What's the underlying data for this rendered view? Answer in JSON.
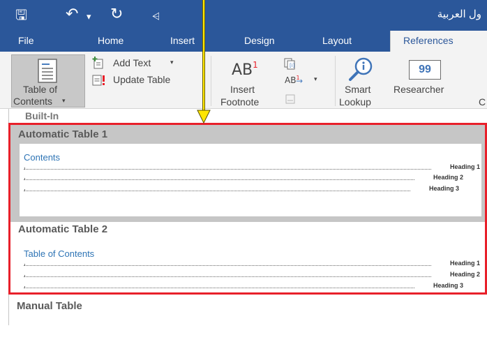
{
  "window": {
    "title": "ول العربية",
    "qat_icons": [
      "save-icon",
      "undo-icon",
      "redo-icon",
      "customize-qat-icon"
    ]
  },
  "tabs": [
    {
      "label": "File"
    },
    {
      "label": "Home"
    },
    {
      "label": "Insert"
    },
    {
      "label": "Design"
    },
    {
      "label": "Layout"
    },
    {
      "label": "References",
      "active": true
    }
  ],
  "ribbon": {
    "toc_button": {
      "line1": "Table of",
      "line2": "Contents",
      "icon": "table-of-contents-icon"
    },
    "add_text": {
      "label": "Add Text",
      "icon": "add-text-icon"
    },
    "update_table": {
      "label": "Update Table",
      "icon": "update-table-icon"
    },
    "insert_footnote": {
      "line1": "Insert",
      "line2": "Footnote",
      "icon": "insert-footnote-icon",
      "glyph": "AB",
      "sup": "1"
    },
    "endnote_glyph": "AB",
    "smart_lookup": {
      "line1": "Smart",
      "line2": "Lookup",
      "icon": "smart-lookup-icon"
    },
    "researcher": {
      "label": "Researcher",
      "icon": "researcher-icon",
      "glyph": "99"
    },
    "cut_label": "C"
  },
  "gallery": {
    "section_label": "Built-In",
    "items": [
      {
        "title": "Automatic Table 1",
        "preview_heading": "Contents",
        "lines": [
          {
            "text": "Heading 1"
          },
          {
            "text": "Heading 2"
          },
          {
            "text": "Heading 3"
          }
        ]
      },
      {
        "title": "Automatic Table 2",
        "preview_heading": "Table of Contents",
        "lines": [
          {
            "text": "Heading 1"
          },
          {
            "text": "Heading 2"
          },
          {
            "text": "Heading 3"
          }
        ]
      }
    ],
    "manual_label": "Manual Table"
  },
  "colors": {
    "ribbon_blue": "#2b579a",
    "highlight_red": "#e8202a",
    "annotation_arrow": "#ffe600",
    "preview_heading": "#2e74b5"
  }
}
